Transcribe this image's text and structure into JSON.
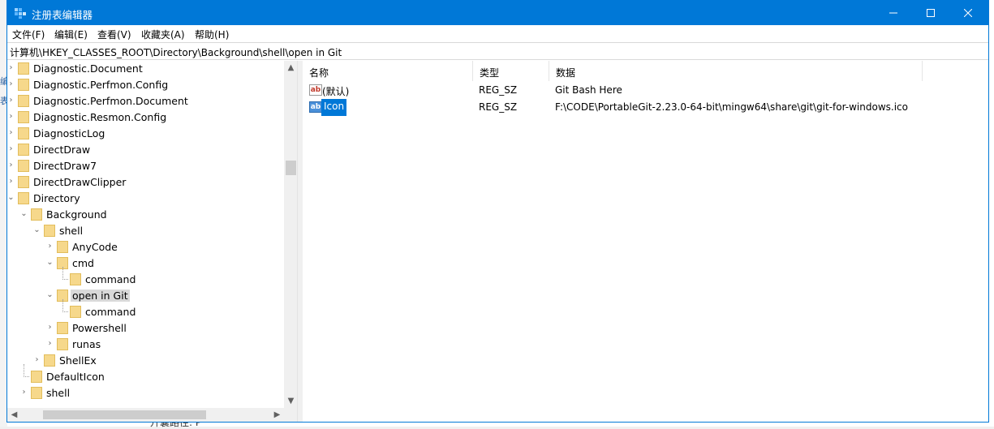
{
  "window": {
    "title": "注册表编辑器",
    "accent": "#0078d7"
  },
  "background_app": {
    "frag1": "编",
    "frag2": "表",
    "bottom_text": "丌囊路径: P"
  },
  "menu": [
    "文件(F)",
    "编辑(E)",
    "查看(V)",
    "收藏夹(A)",
    "帮助(H)"
  ],
  "address": "计算机\\HKEY_CLASSES_ROOT\\Directory\\Background\\shell\\open in Git",
  "tree": [
    {
      "label": "Diagnostic.Document",
      "state": "collapsed"
    },
    {
      "label": "Diagnostic.Perfmon.Config",
      "state": "collapsed"
    },
    {
      "label": "Diagnostic.Perfmon.Document",
      "state": "collapsed"
    },
    {
      "label": "Diagnostic.Resmon.Config",
      "state": "collapsed"
    },
    {
      "label": "DiagnosticLog",
      "state": "collapsed"
    },
    {
      "label": "DirectDraw",
      "state": "collapsed"
    },
    {
      "label": "DirectDraw7",
      "state": "collapsed"
    },
    {
      "label": "DirectDrawClipper",
      "state": "collapsed"
    },
    {
      "label": "Directory",
      "state": "expanded"
    },
    {
      "label": "Background",
      "state": "expanded"
    },
    {
      "label": "shell",
      "state": "expanded"
    },
    {
      "label": "AnyCode",
      "state": "collapsed"
    },
    {
      "label": "cmd",
      "state": "expanded"
    },
    {
      "label": "command",
      "state": "leaf"
    },
    {
      "label": "open in Git",
      "state": "expanded",
      "selected": true
    },
    {
      "label": "command",
      "state": "leaf"
    },
    {
      "label": "Powershell",
      "state": "collapsed"
    },
    {
      "label": "runas",
      "state": "collapsed"
    },
    {
      "label": "ShellEx",
      "state": "collapsed"
    },
    {
      "label": "DefaultIcon",
      "state": "leaf"
    },
    {
      "label": "shell",
      "state": "collapsed"
    }
  ],
  "values": {
    "headers": [
      "名称",
      "类型",
      "数据"
    ],
    "rows": [
      {
        "name": "(默认)",
        "type": "REG_SZ",
        "data": "Git Bash Here",
        "icon": "ab",
        "selected": false
      },
      {
        "name": "Icon",
        "type": "REG_SZ",
        "data": "F:\\CODE\\PortableGit-2.23.0-64-bit\\mingw64\\share\\git\\git-for-windows.ico",
        "icon": "ab",
        "selected": true
      }
    ]
  },
  "icons": {
    "app": "regedit-icon",
    "minimize": "minimize-icon",
    "maximize": "maximize-icon",
    "close": "close-icon",
    "folder": "folder-icon",
    "value": "string-value-icon"
  }
}
